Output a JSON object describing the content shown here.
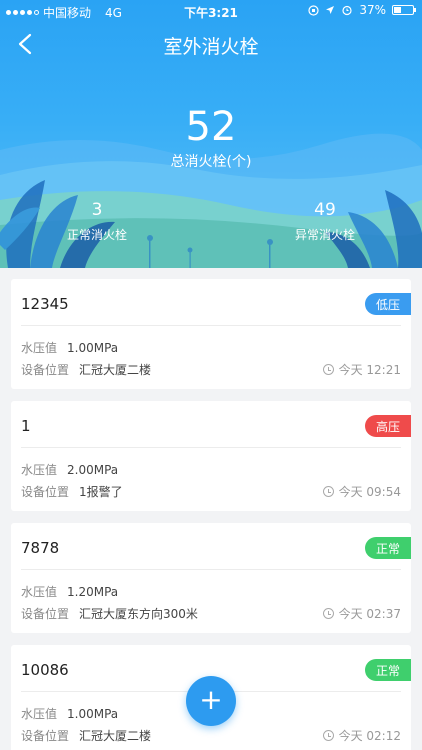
{
  "statusbar": {
    "carrier": "中国移动",
    "network": "4G",
    "time": "下午3:21",
    "battery": "37%",
    "battery_level": 0.37
  },
  "header": {
    "title": "室外消火栓",
    "total_value": "52",
    "total_label": "总消火栓(个)",
    "normal_value": "3",
    "normal_label": "正常消火栓",
    "abnormal_value": "49",
    "abnormal_label": "异常消火栓"
  },
  "labels": {
    "pressure": "水压值",
    "location": "设备位置"
  },
  "colors": {
    "low": "#3a9cf0",
    "high": "#ef4b4b",
    "normal": "#3fcf6d"
  },
  "cards": [
    {
      "title": "12345",
      "status": "低压",
      "status_type": "low",
      "pressure": "1.00MPa",
      "location": "汇冠大厦二楼",
      "time": "今天 12:21"
    },
    {
      "title": "1",
      "status": "高压",
      "status_type": "high",
      "pressure": "2.00MPa",
      "location": "1报警了",
      "time": "今天 09:54"
    },
    {
      "title": "7878",
      "status": "正常",
      "status_type": "normal",
      "pressure": "1.20MPa",
      "location": "汇冠大厦东方向300米",
      "time": "今天 02:37"
    },
    {
      "title": "10086",
      "status": "正常",
      "status_type": "normal",
      "pressure": "1.00MPa",
      "location": "汇冠大厦二楼",
      "time": "今天 02:12"
    }
  ],
  "fab": {
    "icon": "plus-icon",
    "label": "+"
  }
}
